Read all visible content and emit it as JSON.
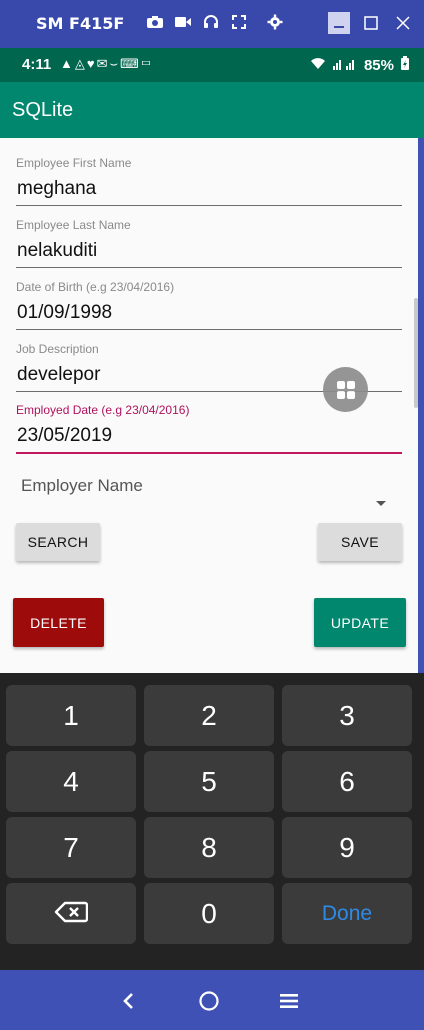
{
  "window": {
    "device_name": "SM F415F",
    "toolbar_icons": [
      "camera-icon",
      "video-icon",
      "headphones-icon",
      "fullscreen-icon",
      "settings-icon"
    ],
    "controls": [
      "minimize-icon",
      "maximize-icon",
      "close-icon"
    ]
  },
  "status_bar": {
    "time": "4:11",
    "notification_icons": "▲◬♥✉︎⌣⌨▭",
    "battery": "85%"
  },
  "app_bar": {
    "title": "SQLite"
  },
  "form": {
    "first_name": {
      "label": "Employee First Name",
      "value": "meghana"
    },
    "last_name": {
      "label": "Employee Last Name",
      "value": "nelakuditi"
    },
    "dob": {
      "label": "Date of Birth (e.g 23/04/2016)",
      "value": "01/09/1998"
    },
    "job": {
      "label": "Job Description",
      "value": "develepor"
    },
    "employed_date": {
      "label": "Employed Date (e.g 23/04/2016)",
      "value": "23/05/2019"
    },
    "employer": {
      "placeholder": "Employer Name"
    }
  },
  "buttons": {
    "search": "SEARCH",
    "save": "SAVE",
    "delete": "DELETE",
    "update": "UPDATE"
  },
  "keyboard": {
    "keys": [
      "1",
      "2",
      "3",
      "4",
      "5",
      "6",
      "7",
      "8",
      "9",
      "⌫",
      "0",
      "Done"
    ],
    "done_color": "#2f8ae6"
  },
  "colors": {
    "app_bar": "#00876e",
    "status_bar": "#00664d",
    "focus_accent": "#c2185b",
    "delete": "#9d0b0b",
    "window_chrome": "#3f51b5"
  }
}
